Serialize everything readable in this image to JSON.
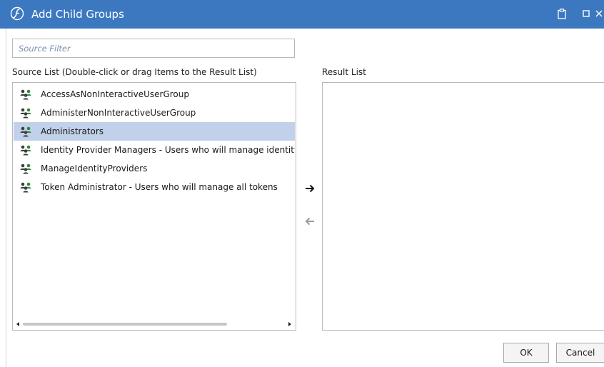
{
  "window": {
    "title": "Add Child Groups",
    "accent": "#3c78c0"
  },
  "filter": {
    "placeholder": "Source Filter",
    "value": ""
  },
  "source": {
    "label": "Source List (Double-click or drag Items to the Result List)",
    "items": [
      {
        "label": "AccessAsNonInteractiveUserGroup",
        "icon": "group-icon",
        "selected": false
      },
      {
        "label": "AdministerNonInteractiveUserGroup",
        "icon": "group-icon",
        "selected": false
      },
      {
        "label": "Administrators",
        "icon": "group-icon",
        "selected": true
      },
      {
        "label": "Identity Provider Managers - Users who will manage identity providers",
        "icon": "group-icon",
        "selected": false
      },
      {
        "label": "ManageIdentityProviders",
        "icon": "group-icon",
        "selected": false
      },
      {
        "label": "Token Administrator - Users who will manage all tokens",
        "icon": "group-icon",
        "selected": false
      }
    ],
    "selection_color": "#c1d1ea"
  },
  "result": {
    "label": "Result List",
    "items": []
  },
  "buttons": {
    "ok": "OK",
    "cancel": "Cancel"
  }
}
